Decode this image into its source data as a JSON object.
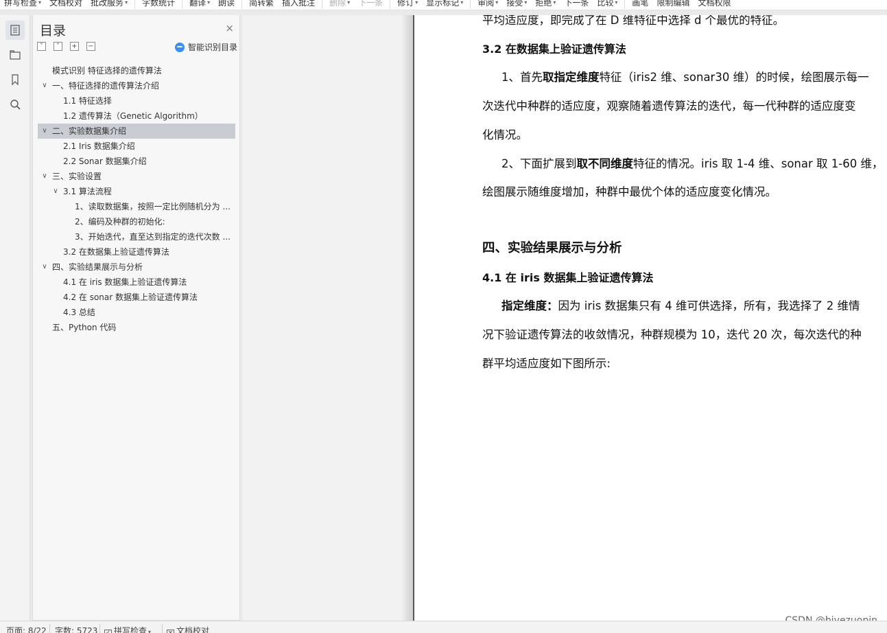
{
  "toolbar": {
    "items": [
      {
        "label": "拼写检查",
        "caret": true,
        "disabled": false
      },
      {
        "label": "文档校对",
        "caret": false,
        "disabled": false
      },
      {
        "label": "批改服务",
        "caret": true,
        "disabled": false
      },
      {
        "label": "字数统计",
        "caret": false,
        "disabled": false
      },
      {
        "label": "翻译",
        "caret": true,
        "disabled": false
      },
      {
        "label": "朗读",
        "caret": false,
        "disabled": false
      },
      {
        "label": "简转繁",
        "caret": false,
        "disabled": false
      },
      {
        "label": "插入批注",
        "caret": false,
        "disabled": false
      },
      {
        "label": "删除",
        "caret": true,
        "disabled": true
      },
      {
        "label": "下一条",
        "caret": false,
        "disabled": true
      },
      {
        "label": "修订",
        "caret": true,
        "disabled": false
      },
      {
        "label": "显示标记",
        "caret": true,
        "disabled": false
      },
      {
        "label": "审阅",
        "caret": true,
        "disabled": false
      },
      {
        "label": "接受",
        "caret": true,
        "disabled": false
      },
      {
        "label": "拒绝",
        "caret": true,
        "disabled": false
      },
      {
        "label": "下一条",
        "caret": false,
        "disabled": false
      },
      {
        "label": "比较",
        "caret": true,
        "disabled": false
      },
      {
        "label": "画笔",
        "caret": false,
        "disabled": false
      },
      {
        "label": "限制编辑",
        "caret": false,
        "disabled": false
      },
      {
        "label": "文档权限",
        "caret": false,
        "disabled": false
      }
    ]
  },
  "outline": {
    "title": "目录",
    "close": "×",
    "smart_label": "智能识别目录",
    "items": [
      {
        "text": "模式识别  特征选择的遗传算法",
        "level": 0,
        "chevron": "",
        "selected": false
      },
      {
        "text": "一、特征选择的遗传算法介绍",
        "level": 0,
        "chevron": "∨",
        "selected": false
      },
      {
        "text": "1.1  特征选择",
        "level": 1,
        "chevron": "",
        "selected": false
      },
      {
        "text": "1.2  遗传算法（Genetic Algorithm）",
        "level": 1,
        "chevron": "",
        "selected": false
      },
      {
        "text": "二、实验数据集介绍",
        "level": 0,
        "chevron": "∨",
        "selected": true
      },
      {
        "text": "2.1 Iris 数据集介绍",
        "level": 1,
        "chevron": "",
        "selected": false
      },
      {
        "text": "2.2 Sonar 数据集介绍",
        "level": 1,
        "chevron": "",
        "selected": false
      },
      {
        "text": "三、实验设置",
        "level": 0,
        "chevron": "∨",
        "selected": false
      },
      {
        "text": "3.1  算法流程",
        "level": 1,
        "chevron": "∨",
        "selected": false
      },
      {
        "text": "1、读取数据集，按照一定比例随机分为 ...",
        "level": 2,
        "chevron": "",
        "selected": false
      },
      {
        "text": "2、编码及种群的初始化:",
        "level": 2,
        "chevron": "",
        "selected": false
      },
      {
        "text": "3、开始迭代，直至达到指定的迭代次数 ...",
        "level": 2,
        "chevron": "",
        "selected": false
      },
      {
        "text": "3.2  在数据集上验证遗传算法",
        "level": 1,
        "chevron": "",
        "selected": false
      },
      {
        "text": "四、实验结果展示与分析",
        "level": 0,
        "chevron": "∨",
        "selected": false
      },
      {
        "text": "4.1  在 iris 数据集上验证遗传算法",
        "level": 1,
        "chevron": "",
        "selected": false
      },
      {
        "text": "4.2  在 sonar 数据集上验证遗传算法",
        "level": 1,
        "chevron": "",
        "selected": false
      },
      {
        "text": "4.3  总结",
        "level": 1,
        "chevron": "",
        "selected": false
      },
      {
        "text": "五、Python 代码",
        "level": 0,
        "chevron": "",
        "selected": false
      }
    ]
  },
  "document": {
    "top_line": "平均适应度，即完成了在 D 维特征中选择 d 个最优的特征。",
    "sec_3_2": "3.2  在数据集上验证遗传算法",
    "para1_line1": [
      "1、首先",
      "取指定维度",
      "特征（iris2 维、sonar30 维）的时候，绘图展示每一"
    ],
    "para1_line2": "次迭代中种群的适应度，观察随着遗传算法的迭代，每一代种群的适应度变",
    "para1_line3": "化情况。",
    "para2_line1": [
      "2、下面扩展到",
      "取不同维度",
      "特征的情况。iris 取 1-4 维、sonar 取 1-60 维，"
    ],
    "para2_line2": "绘图展示随维度增加，种群中最优个体的适应度变化情况。",
    "chap4": "四、实验结果展示与分析",
    "sec_4_1": "4.1  在 iris 数据集上验证遗传算法",
    "para3_line1": [
      "指定维度：",
      "因为 iris 数据集只有 4 维可供选择，所有，我选择了 2 维情"
    ],
    "para3_line2": "况下验证遗传算法的收敛情况，种群规模为 10，迭代 20 次，每次迭代的种",
    "para3_line3": "群平均适应度如下图所示:"
  },
  "statusbar": {
    "page": "页面: 8/22",
    "words": "字数: 5723",
    "spell": "拼写检查",
    "proof": "文档校对"
  },
  "watermark": "CSDN @biyezuopin"
}
